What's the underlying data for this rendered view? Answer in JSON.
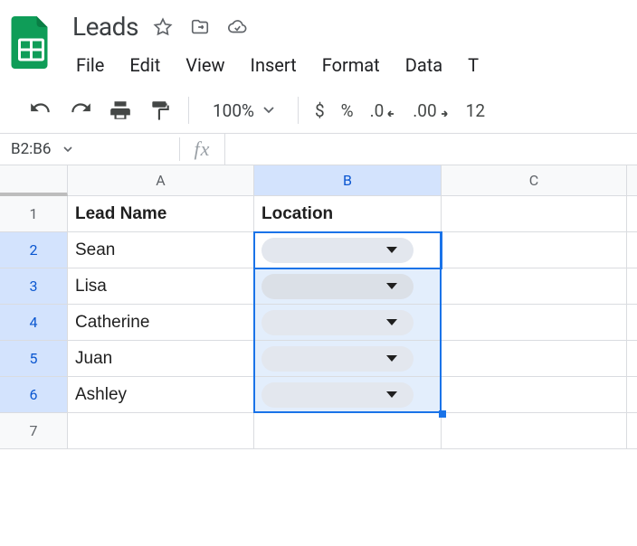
{
  "doc": {
    "title": "Leads"
  },
  "menu": {
    "file": "File",
    "edit": "Edit",
    "view": "View",
    "insert": "Insert",
    "format": "Format",
    "data": "Data",
    "tools": "T"
  },
  "toolbar": {
    "zoom": "100%",
    "currency": "$",
    "percent": "%",
    "dec_less": ".0",
    "dec_more": ".00",
    "font_size": "12"
  },
  "fx": {
    "name_box": "B2:B6",
    "formula": ""
  },
  "cols": {
    "a": "A",
    "b": "B",
    "c": "C"
  },
  "rows": {
    "r1": "1",
    "r2": "2",
    "r3": "3",
    "r4": "4",
    "r5": "5",
    "r6": "6",
    "r7": "7"
  },
  "cells": {
    "a1": "Lead Name",
    "b1": "Location",
    "a2": "Sean",
    "a3": "Lisa",
    "a4": "Catherine",
    "a5": "Juan",
    "a6": "Ashley"
  }
}
